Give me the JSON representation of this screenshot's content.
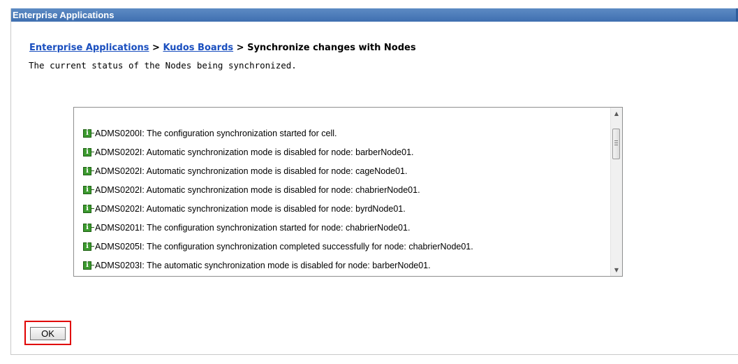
{
  "panel": {
    "title": "Enterprise Applications"
  },
  "breadcrumb": {
    "link1": "Enterprise Applications",
    "separator1": " > ",
    "link2": "Kudos Boards",
    "separator2": " > ",
    "current": "Synchronize changes with Nodes"
  },
  "description": "The current status of the Nodes being synchronized.",
  "log": {
    "icon": "info-icon",
    "icon_color": "#3c9a2f",
    "messages": [
      "ADMS0200I: The configuration synchronization started for cell.",
      "ADMS0202I: Automatic synchronization mode is disabled for node: barberNode01.",
      "ADMS0202I: Automatic synchronization mode is disabled for node: cageNode01.",
      "ADMS0202I: Automatic synchronization mode is disabled for node: chabrierNode01.",
      "ADMS0202I: Automatic synchronization mode is disabled for node: byrdNode01.",
      "ADMS0201I: The configuration synchronization started for node: chabrierNode01.",
      "ADMS0205I: The configuration synchronization completed successfully for node: chabrierNode01.",
      "ADMS0203I: The automatic synchronization mode is disabled for node: barberNode01."
    ]
  },
  "actions": {
    "ok_label": "OK",
    "highlight_color": "#e00000"
  }
}
